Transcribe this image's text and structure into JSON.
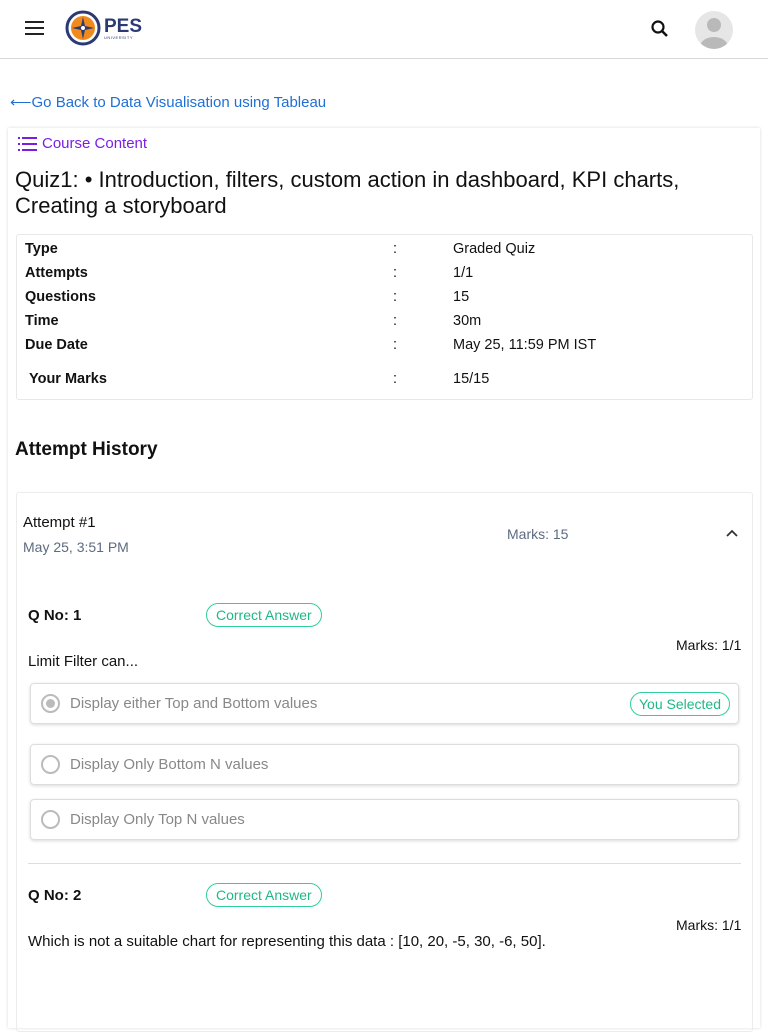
{
  "header": {
    "logo_main": "PES",
    "logo_sub": "UNIVERSITY"
  },
  "back_link": "Go Back to Data Visualisation using Tableau",
  "course_content": "Course Content",
  "title": "Quiz1: • Introduction, filters, custom action in dashboard, KPI charts, Creating a storyboard",
  "info": [
    {
      "key": "Type",
      "value": "Graded Quiz"
    },
    {
      "key": "Attempts",
      "value": "1/1"
    },
    {
      "key": "Questions",
      "value": "15"
    },
    {
      "key": "Time",
      "value": "30m"
    },
    {
      "key": "Due Date",
      "value": "May 25, 11:59 PM IST"
    },
    {
      "key": "Your Marks",
      "value": "15/15"
    }
  ],
  "colon": ":",
  "attempt_history": "Attempt History",
  "attempt": {
    "title": "Attempt #1",
    "date": "May 25, 3:51 PM",
    "marks": "Marks: 15"
  },
  "questions": [
    {
      "number": "Q No: 1",
      "status": "Correct Answer",
      "marks": "Marks: 1/1",
      "text": "Limit Filter can...",
      "options": [
        {
          "text": "Display either Top and Bottom values",
          "selected": true,
          "badge": "You Selected"
        },
        {
          "text": "Display Only Bottom N values"
        },
        {
          "text": "Display Only Top N values"
        }
      ]
    },
    {
      "number": "Q No: 2",
      "status": "Correct Answer",
      "marks": "Marks: 1/1",
      "text": "Which is not a suitable chart for representing this data : [10, 20, -5, 30, -6, 50]."
    }
  ]
}
